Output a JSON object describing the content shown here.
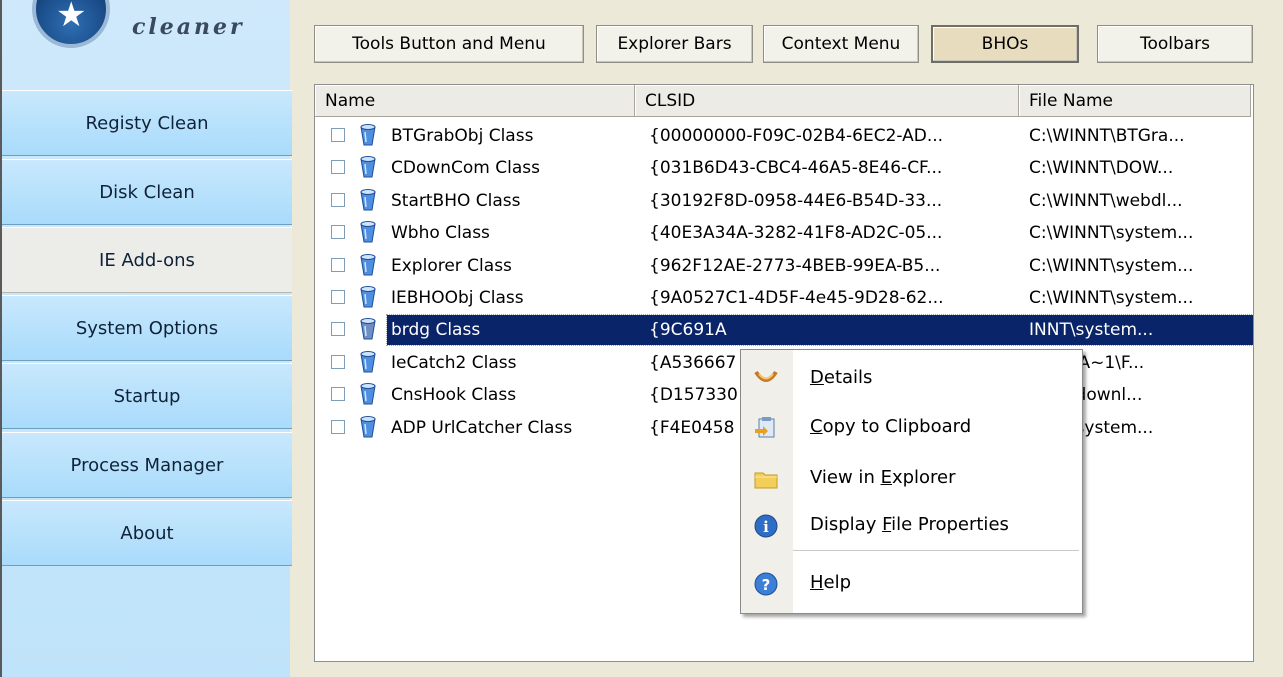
{
  "app": {
    "logo_text": "cleaner"
  },
  "sidebar": {
    "items": [
      {
        "label": "Registy Clean"
      },
      {
        "label": "Disk Clean"
      },
      {
        "label": "IE Add-ons"
      },
      {
        "label": "System Options"
      },
      {
        "label": "Startup"
      },
      {
        "label": "Process Manager"
      },
      {
        "label": "About"
      }
    ],
    "active_item": "IE Add-ons"
  },
  "tabs": {
    "items": [
      {
        "label": "Tools Button and  Menu"
      },
      {
        "label": "Explorer Bars"
      },
      {
        "label": "Context Menu"
      },
      {
        "label": "BHOs"
      },
      {
        "label": "Toolbars"
      }
    ],
    "active_tab": "BHOs"
  },
  "list": {
    "columns": [
      "Name",
      "CLSID",
      "File Name"
    ],
    "rows": [
      {
        "name": "BTGrabObj Class",
        "clsid": "{00000000-F09C-02B4-6EC2-AD...",
        "file": "C:\\WINNT\\BTGra...",
        "checked": false
      },
      {
        "name": "CDownCom Class",
        "clsid": "{031B6D43-CBC4-46A5-8E46-CF...",
        "file": "C:\\WINNT\\DOW...",
        "checked": false
      },
      {
        "name": "StartBHO Class",
        "clsid": "{30192F8D-0958-44E6-B54D-33...",
        "file": "C:\\WINNT\\webdl...",
        "checked": false
      },
      {
        "name": "Wbho Class",
        "clsid": "{40E3A34A-3282-41F8-AD2C-05...",
        "file": "C:\\WINNT\\system...",
        "checked": false
      },
      {
        "name": "Explorer Class",
        "clsid": "{962F12AE-2773-4BEB-99EA-B5...",
        "file": "C:\\WINNT\\system...",
        "checked": false
      },
      {
        "name": "IEBHOObj Class",
        "clsid": "{9A0527C1-4D5F-4e45-9D28-62...",
        "file": "C:\\WINNT\\system...",
        "checked": false
      },
      {
        "name": "brdg Class",
        "clsid": "{9C691A",
        "file": "INNT\\system...",
        "checked": false,
        "selected": true
      },
      {
        "name": "IeCatch2 Class",
        "clsid": "{A536667",
        "file": "ROGRA~1\\F...",
        "checked": false
      },
      {
        "name": "CnsHook Class",
        "clsid": "{D157330",
        "file": "INNT\\downl...",
        "checked": false
      },
      {
        "name": "ADP UrlCatcher Class",
        "clsid": "{F4E0458",
        "file": "INNT\\system...",
        "checked": false
      }
    ]
  },
  "context_menu": {
    "items": [
      {
        "label": "Details",
        "icon": "details-icon"
      },
      {
        "label": "Copy to Clipboard",
        "icon": "clipboard-icon"
      },
      {
        "label": "View in Explorer",
        "icon": "folder-icon"
      },
      {
        "label": "Display File Properties",
        "icon": "info-icon"
      },
      {
        "label": "Help",
        "icon": "help-icon"
      }
    ]
  },
  "colors": {
    "selection": "#0a246a",
    "sidebar": "#a9dbfb",
    "active_tab": "#e7dcbe"
  }
}
